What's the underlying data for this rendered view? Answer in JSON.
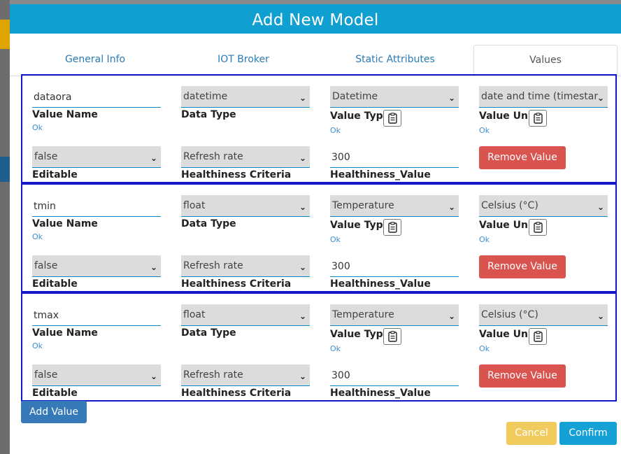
{
  "modal": {
    "title": "Add New Model",
    "tabs": [
      {
        "label": "General Info"
      },
      {
        "label": "IOT Broker"
      },
      {
        "label": "Static Attributes"
      },
      {
        "label": "Values",
        "active": true
      }
    ],
    "labels": {
      "value_name": "Value Name",
      "data_type": "Data Type",
      "value_type": "Value Type",
      "value_unit": "Value Unit",
      "editable": "Editable",
      "healthiness_criteria": "Healthiness Criteria",
      "healthiness_value": "Healthiness_Value",
      "ok": "Ok",
      "remove_button": "Remove Value"
    },
    "values": [
      {
        "value_name": "dataora",
        "data_type": "datetime",
        "value_type": "Datetime",
        "value_unit": "date and time (timestar",
        "editable": "false",
        "healthiness_criteria": "Refresh rate",
        "healthiness_value": "300"
      },
      {
        "value_name": "tmin",
        "data_type": "float",
        "value_type": "Temperature",
        "value_unit": "Celsius (°C)",
        "editable": "false",
        "healthiness_criteria": "Refresh rate",
        "healthiness_value": "300"
      },
      {
        "value_name": "tmax",
        "data_type": "float",
        "value_type": "Temperature",
        "value_unit": "Celsius (°C)",
        "editable": "false",
        "healthiness_criteria": "Refresh rate",
        "healthiness_value": "300"
      }
    ],
    "add_value_button": "Add Value",
    "cancel_button": "Cancel",
    "confirm_button": "Confirm"
  },
  "colors": {
    "header_bg": "#109fd1",
    "block_border": "#1515c9",
    "remove_button": "#d9534f",
    "add_button": "#3579b9",
    "cancel_button": "#f0cc5f",
    "confirm_button": "#15a1d5"
  },
  "icons": {
    "clipboard": "clipboard-icon",
    "chevron": "chevron-down-icon"
  }
}
